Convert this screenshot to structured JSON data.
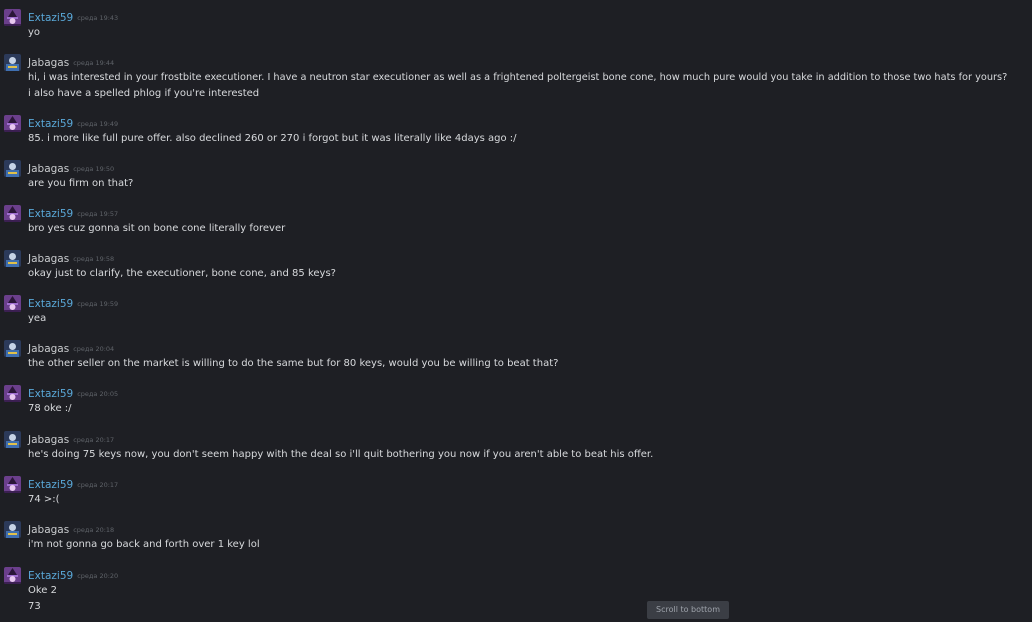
{
  "chat": {
    "messages": [
      {
        "author": "Extazi59",
        "author_color": "#5aa8d8",
        "avatar": "purple-wizard-avatar-icon",
        "timestamp": "среда 19:43",
        "lines": [
          "yo"
        ]
      },
      {
        "author": "Jabagas",
        "author_color": "#c9cbce",
        "avatar": "blue-character-avatar-icon",
        "timestamp": "среда 19:44",
        "lines": [
          "hi, i was interested in your frostbite executioner. I have a neutron star executioner as well as a frightened poltergeist bone cone, how much pure would you take in addition to those two hats for yours?",
          "i also have a spelled phlog if you're interested"
        ]
      },
      {
        "author": "Extazi59",
        "author_color": "#5aa8d8",
        "avatar": "purple-wizard-avatar-icon",
        "timestamp": "среда 19:49",
        "lines": [
          "85. i more like full pure offer. also declined 260 or 270 i forgot but it was literally like 4days ago :/"
        ]
      },
      {
        "author": "Jabagas",
        "author_color": "#c9cbce",
        "avatar": "blue-character-avatar-icon",
        "timestamp": "среда 19:50",
        "lines": [
          "are you firm on that?"
        ]
      },
      {
        "author": "Extazi59",
        "author_color": "#5aa8d8",
        "avatar": "purple-wizard-avatar-icon",
        "timestamp": "среда 19:57",
        "lines": [
          "bro yes cuz gonna sit on bone cone literally forever"
        ]
      },
      {
        "author": "Jabagas",
        "author_color": "#c9cbce",
        "avatar": "blue-character-avatar-icon",
        "timestamp": "среда 19:58",
        "lines": [
          "okay just to clarify, the executioner, bone cone, and 85 keys?"
        ]
      },
      {
        "author": "Extazi59",
        "author_color": "#5aa8d8",
        "avatar": "purple-wizard-avatar-icon",
        "timestamp": "среда 19:59",
        "lines": [
          "yea"
        ]
      },
      {
        "author": "Jabagas",
        "author_color": "#c9cbce",
        "avatar": "blue-character-avatar-icon",
        "timestamp": "среда 20:04",
        "lines": [
          "the other seller on the market is willing to do the same but for 80 keys, would you be willing to beat that?"
        ]
      },
      {
        "author": "Extazi59",
        "author_color": "#5aa8d8",
        "avatar": "purple-wizard-avatar-icon",
        "timestamp": "среда 20:05",
        "lines": [
          "78 oke :/"
        ]
      },
      {
        "author": "Jabagas",
        "author_color": "#c9cbce",
        "avatar": "blue-character-avatar-icon",
        "timestamp": "среда 20:17",
        "lines": [
          "he's doing 75 keys now, you don't seem happy with the deal so i'll quit bothering you now if you aren't able to beat his offer."
        ]
      },
      {
        "author": "Extazi59",
        "author_color": "#5aa8d8",
        "avatar": "purple-wizard-avatar-icon",
        "timestamp": "среда 20:17",
        "lines": [
          "74 >:("
        ]
      },
      {
        "author": "Jabagas",
        "author_color": "#c9cbce",
        "avatar": "blue-character-avatar-icon",
        "timestamp": "среда 20:18",
        "lines": [
          "i'm not gonna go back and forth over 1 key lol"
        ]
      },
      {
        "author": "Extazi59",
        "author_color": "#5aa8d8",
        "avatar": "purple-wizard-avatar-icon",
        "timestamp": "среда 20:20",
        "lines": [
          "Oke 2",
          "73"
        ]
      }
    ],
    "scroll_to_bottom_label": "Scroll to bottom",
    "colors": {
      "background": "#1e1f24",
      "author_extazi": "#5aa8d8",
      "author_jabagas": "#c9cbce",
      "message_text": "#d8dadd",
      "timestamp": "#5f6369"
    }
  }
}
